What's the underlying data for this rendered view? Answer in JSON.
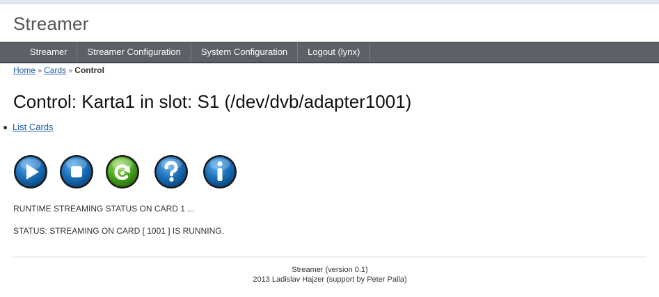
{
  "app": {
    "title": "Streamer"
  },
  "nav": {
    "items": [
      {
        "label": "Streamer"
      },
      {
        "label": "Streamer Configuration"
      },
      {
        "label": "System Configuration"
      },
      {
        "label": "Logout (lynx)"
      }
    ]
  },
  "breadcrumb": {
    "home": "Home",
    "separator": "»",
    "cards": "Cards",
    "current": "Control"
  },
  "page": {
    "title": "Control: Karta1 in slot: S1 (/dev/dvb/adapter1001)",
    "links": {
      "list_cards": "List Cards"
    }
  },
  "controls": {
    "buttons": [
      {
        "icon": "play-icon",
        "color": "#1b6fb8"
      },
      {
        "icon": "stop-icon",
        "color": "#1b6fb8"
      },
      {
        "icon": "restart-icon",
        "color": "#4aa51f"
      },
      {
        "icon": "help-icon",
        "color": "#1b6fb8"
      },
      {
        "icon": "info-icon",
        "color": "#1b6fb8"
      }
    ]
  },
  "status": {
    "runtime": "RUNTIME STREAMING STATUS ON CARD 1 ...",
    "state": "STATUS: STREAMING ON CARD [ 1001 ] IS RUNNING."
  },
  "footer": {
    "line1": "Streamer (version 0.1)",
    "line2": "2013 Ladislav Hajzer (support by Peter Palla)"
  }
}
